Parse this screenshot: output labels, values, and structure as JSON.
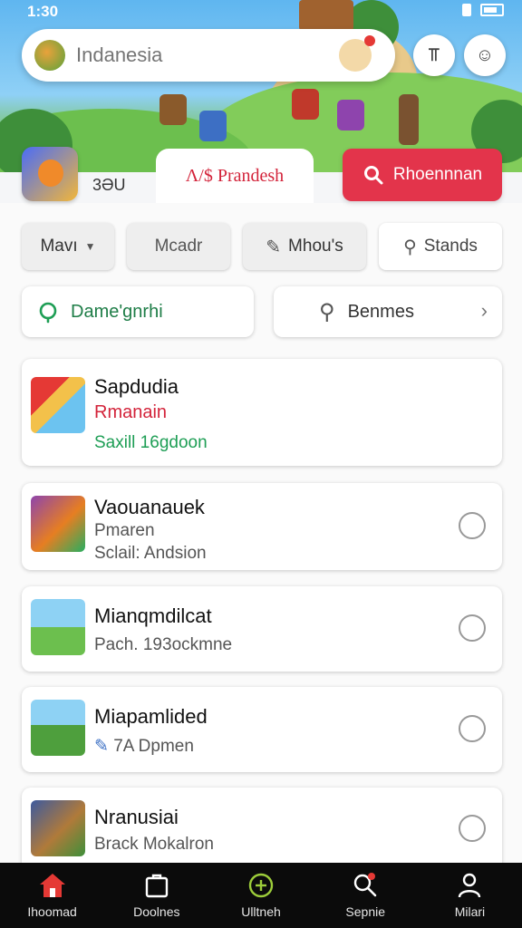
{
  "status_bar": {
    "time": "1:30"
  },
  "search": {
    "placeholder": "Indanesia"
  },
  "header": {
    "points": "3ƏU",
    "tab_label": "Λ/$ Prandesh",
    "action_label": "Rhoennnan"
  },
  "filters": [
    {
      "label": "Mavı"
    },
    {
      "label": "Mcadr"
    },
    {
      "label": "Mhou's"
    },
    {
      "label": "Stands"
    }
  ],
  "actions": {
    "left_label": "Dame'gnrhi",
    "right_label": "Benmes"
  },
  "list": [
    {
      "title": "Sapdudia",
      "subtitle": "Rmanain",
      "meta": "Saxill 16gdoon"
    },
    {
      "title": "Vaouanauek",
      "subtitle": "Pmaren",
      "meta": "Sclail: Andsion"
    },
    {
      "title": "Mianqmdilcat",
      "meta": "Pach. 193ockmne"
    },
    {
      "title": "Miapamlided",
      "meta": "7A Dpmen"
    },
    {
      "title": "Nranusiai",
      "meta": "Brack Mokalron"
    }
  ],
  "bottom_nav": [
    {
      "label": "Ihoomad",
      "icon": "home-icon"
    },
    {
      "label": "Doolnes",
      "icon": "bag-icon"
    },
    {
      "label": "Ulltneh",
      "icon": "plus-circle-icon"
    },
    {
      "label": "Sepnie",
      "icon": "search-icon"
    },
    {
      "label": "Milari",
      "icon": "profile-icon"
    }
  ],
  "colors": {
    "accent_red": "#e3344b",
    "accent_green": "#1e9e55",
    "nav_bg": "#0b0b0b"
  }
}
